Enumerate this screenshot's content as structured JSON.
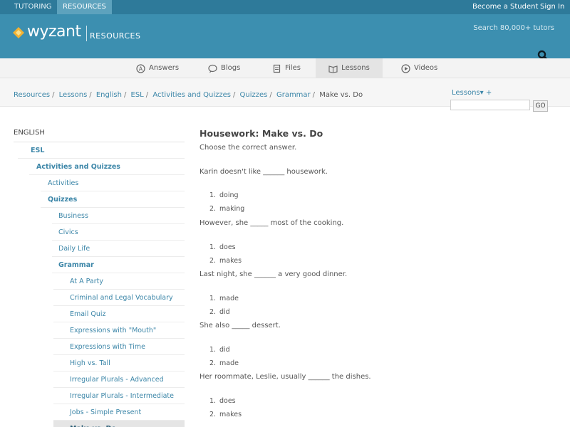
{
  "topbar": {
    "tabs": [
      {
        "label": "TUTORING",
        "active": false
      },
      {
        "label": "RESOURCES",
        "active": true
      }
    ],
    "become_student": "Become a Student",
    "sign_in": "Sign In"
  },
  "header": {
    "logo_text": "wyzant",
    "logo_section": "RESOURCES",
    "search_hint": "Search 80,000+ tutors",
    "icons": {
      "search": "search-icon",
      "logo": "diamond-logo-icon"
    }
  },
  "nav": {
    "items": [
      {
        "label": "Answers",
        "icon": "answers-icon"
      },
      {
        "label": "Blogs",
        "icon": "blogs-icon"
      },
      {
        "label": "Files",
        "icon": "files-icon"
      },
      {
        "label": "Lessons",
        "icon": "lessons-icon",
        "active": true
      },
      {
        "label": "Videos",
        "icon": "videos-icon"
      }
    ]
  },
  "breadcrumb": {
    "links": [
      "Resources",
      "Lessons",
      "English",
      "ESL",
      "Activities and Quizzes",
      "Quizzes",
      "Grammar"
    ],
    "current": "Make vs. Do"
  },
  "search": {
    "dropdown_label": "Lessons▾ +",
    "input_value": "",
    "go_label": "GO"
  },
  "sidebar": {
    "heading": "ENGLISH",
    "items": [
      {
        "label": "ESL",
        "bold": true
      },
      {
        "label": "Activities and Quizzes",
        "bold": true
      },
      {
        "label": "Activities",
        "bold": false
      },
      {
        "label": "Quizzes",
        "bold": true
      },
      {
        "label": "Business",
        "bold": false
      },
      {
        "label": "Civics",
        "bold": false
      },
      {
        "label": "Daily Life",
        "bold": false
      },
      {
        "label": "Grammar",
        "bold": true
      },
      {
        "label": "At A Party",
        "bold": false
      },
      {
        "label": "Criminal and Legal Vocabulary",
        "bold": false
      },
      {
        "label": "Email Quiz",
        "bold": false
      },
      {
        "label": "Expressions with \"Mouth\"",
        "bold": false
      },
      {
        "label": "Expressions with Time",
        "bold": false
      },
      {
        "label": "High vs. Tall",
        "bold": false
      },
      {
        "label": "Irregular Plurals - Advanced",
        "bold": false
      },
      {
        "label": "Irregular Plurals - Intermediate",
        "bold": false
      },
      {
        "label": "Jobs - Simple Present",
        "bold": false
      },
      {
        "label": "Make vs. Do",
        "bold": false,
        "active": true
      }
    ]
  },
  "main": {
    "title": "Housework: Make vs. Do",
    "instructions": "Choose the correct answer.",
    "questions": [
      {
        "text": "Karin doesn't like ______ housework.",
        "options": [
          "doing",
          "making"
        ]
      },
      {
        "text": "However, she _____ most of the cooking.",
        "options": [
          "does",
          "makes"
        ]
      },
      {
        "text": "Last night, she ______ a very good dinner.",
        "options": [
          "made",
          "did"
        ]
      },
      {
        "text": "She also _____ dessert.",
        "options": [
          "did",
          "made"
        ]
      },
      {
        "text": "Her roommate, Leslie, usually ______ the dishes.",
        "options": [
          "does",
          "makes"
        ]
      }
    ]
  },
  "colors": {
    "topbar": "#2e7a9a",
    "header": "#3c8fb0",
    "link": "#3c86a8"
  }
}
